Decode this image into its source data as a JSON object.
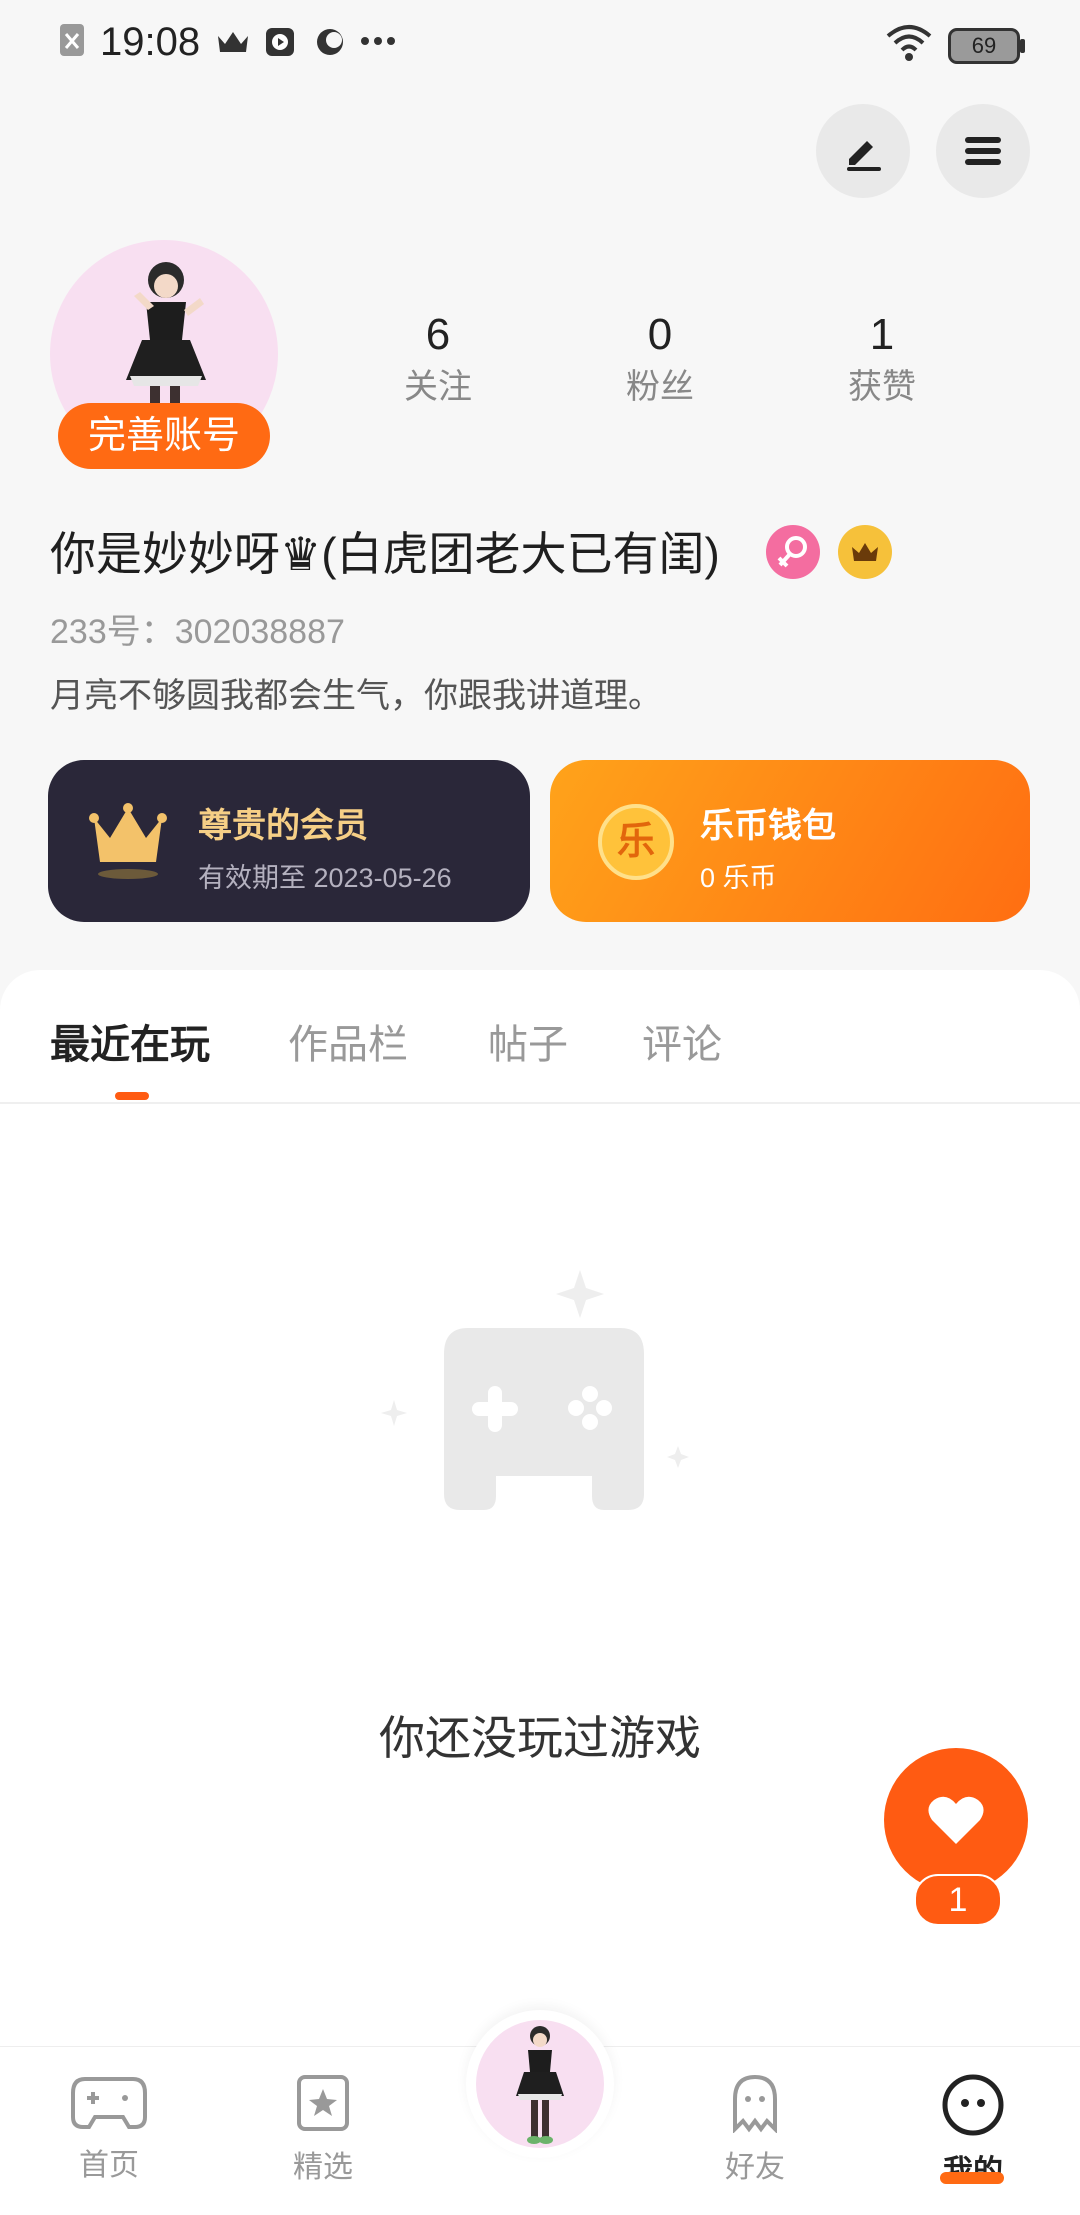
{
  "status_bar": {
    "time": "19:08",
    "battery": "69"
  },
  "profile": {
    "complete_label": "完善账号",
    "stats": [
      {
        "value": "6",
        "label": "关注"
      },
      {
        "value": "0",
        "label": "粉丝"
      },
      {
        "value": "1",
        "label": "获赞"
      }
    ],
    "username": "你是妙妙呀♛(白虎团老大已有闺)",
    "id_line": "233号：302038887",
    "bio": "月亮不够圆我都会生气，你跟我讲道理。"
  },
  "cards": {
    "vip": {
      "title": "尊贵的会员",
      "sub": "有效期至 2023-05-26"
    },
    "coin": {
      "title": "乐币钱包",
      "sub": "0 乐币",
      "icon_char": "乐"
    }
  },
  "tabs": [
    "最近在玩",
    "作品栏",
    "帖子",
    "评论"
  ],
  "empty_state": {
    "text": "你还没玩过游戏"
  },
  "like_fab": {
    "count": "1"
  },
  "nav": {
    "items": [
      {
        "label": "首页"
      },
      {
        "label": "精选"
      },
      {
        "label": "好友"
      },
      {
        "label": "我的"
      }
    ]
  },
  "colors": {
    "accent": "#ff5b12",
    "vip_gold": "#f6cf86",
    "card_dark": "#2a2739"
  }
}
